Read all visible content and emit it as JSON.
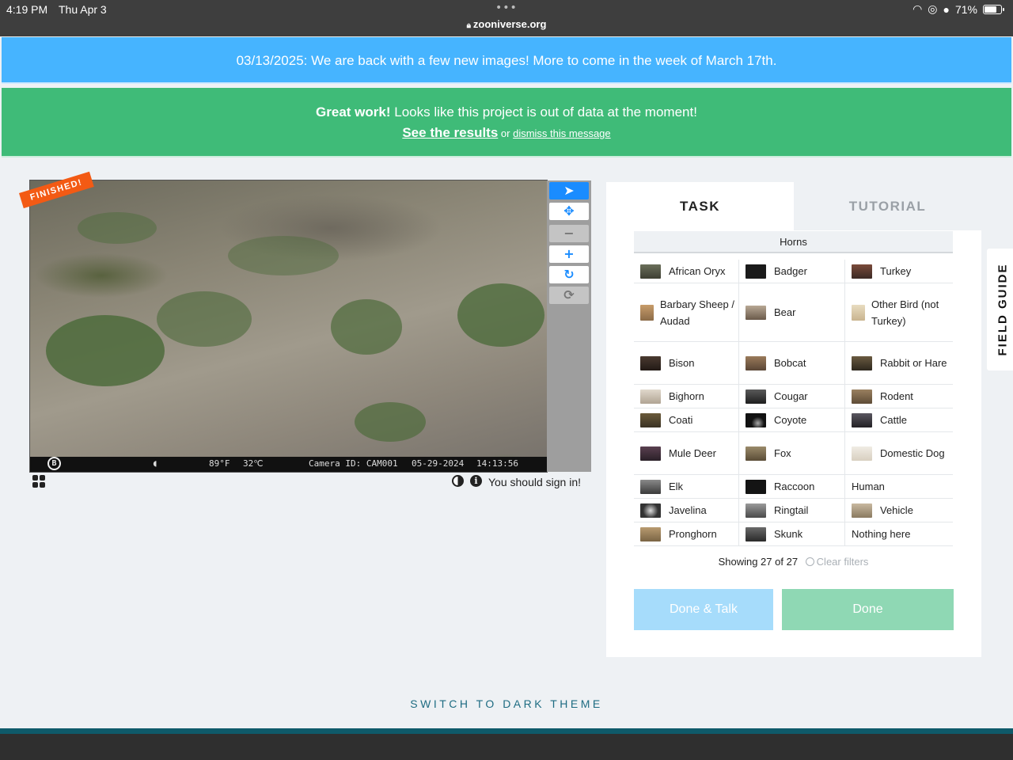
{
  "status_bar": {
    "time": "4:19 PM",
    "date": "Thu Apr 3",
    "url": "zooniverse.org",
    "battery": "71%"
  },
  "announcement": {
    "text": "03/13/2025: We are back with a few new images! More to come in the week of March 17th."
  },
  "out_of_data": {
    "bold": "Great work!",
    "text": " Looks like this project is out of data at the moment!",
    "results_link": "See the results",
    "or": " or ",
    "dismiss_link": "dismiss this message"
  },
  "viewer": {
    "badge": "FINISHED!",
    "photo_info": {
      "temp_f": "89°F",
      "temp_c": "32℃",
      "camera": "Camera ID: CAM001",
      "date": "05-29-2024",
      "time": "14:13:56"
    },
    "tools": [
      {
        "name": "pointer-icon",
        "glyph": "➤"
      },
      {
        "name": "move-icon",
        "glyph": "✥"
      },
      {
        "name": "zoom-out-icon",
        "glyph": "−"
      },
      {
        "name": "zoom-in-icon",
        "glyph": "+"
      },
      {
        "name": "rotate-icon",
        "glyph": "↻"
      },
      {
        "name": "reset-icon",
        "glyph": "⟳"
      }
    ],
    "signin": "You should sign in!"
  },
  "task_panel": {
    "tabs": [
      "TASK",
      "TUTORIAL"
    ],
    "filter_label": "Horns",
    "species": [
      [
        "African Oryx",
        "Badger",
        "Turkey"
      ],
      [
        "Barbary Sheep / Audad",
        "Bear",
        "Other Bird (not Turkey)"
      ],
      [
        "Bison",
        "Bobcat",
        "Rabbit or Hare"
      ],
      [
        "Bighorn",
        "Cougar",
        "Rodent"
      ],
      [
        "Coati",
        "Coyote",
        "Cattle"
      ],
      [
        "Mule Deer",
        "Fox",
        "Domestic Dog"
      ],
      [
        "Elk",
        "Raccoon",
        "Human"
      ],
      [
        "Javelina",
        "Ringtail",
        "Vehicle"
      ],
      [
        "Pronghorn",
        "Skunk",
        "Nothing here"
      ]
    ],
    "showing": "Showing 27 of 27",
    "clear_filters": "Clear filters",
    "done_talk": "Done & Talk",
    "done": "Done"
  },
  "field_guide": "FIELD GUIDE",
  "dark_theme_link": "SWITCH TO DARK THEME",
  "colors": {
    "announcement": "#46b4ff",
    "success": "#3fbb78",
    "finished_badge": "#f35a14",
    "tool_active": "#1a8cff"
  }
}
